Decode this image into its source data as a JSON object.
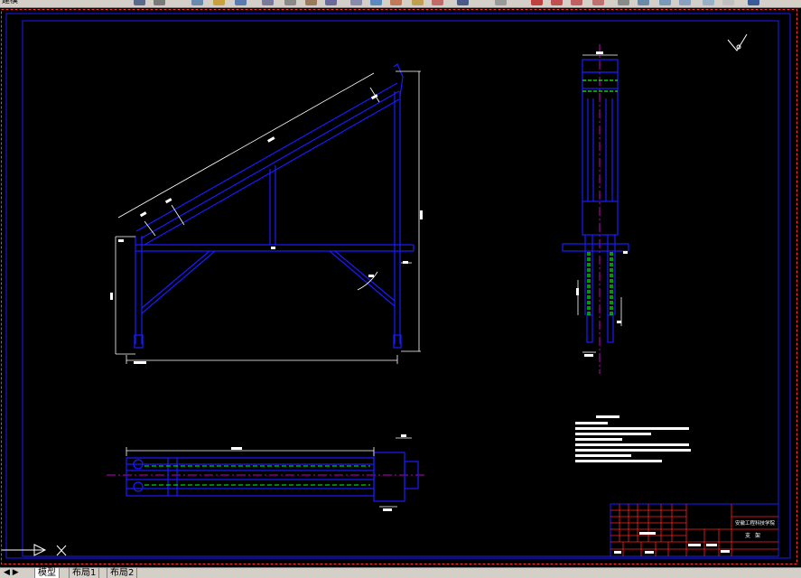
{
  "toolbar": {
    "layer_label": "建模"
  },
  "layout_tabs": [
    {
      "label": "模型",
      "active": true
    },
    {
      "label": "布局1",
      "active": false
    },
    {
      "label": "布局2",
      "active": false
    }
  ],
  "title_block": {
    "institution": "安徽工程科技学院",
    "part_name": "支架"
  },
  "colors": {
    "background": "#000000",
    "frame": "#1a1aff",
    "dimension": "#ffffff",
    "centerline": "#ff00ff",
    "hidden": "#00ff00",
    "border": "#ff3333",
    "table": "#ff2020"
  }
}
